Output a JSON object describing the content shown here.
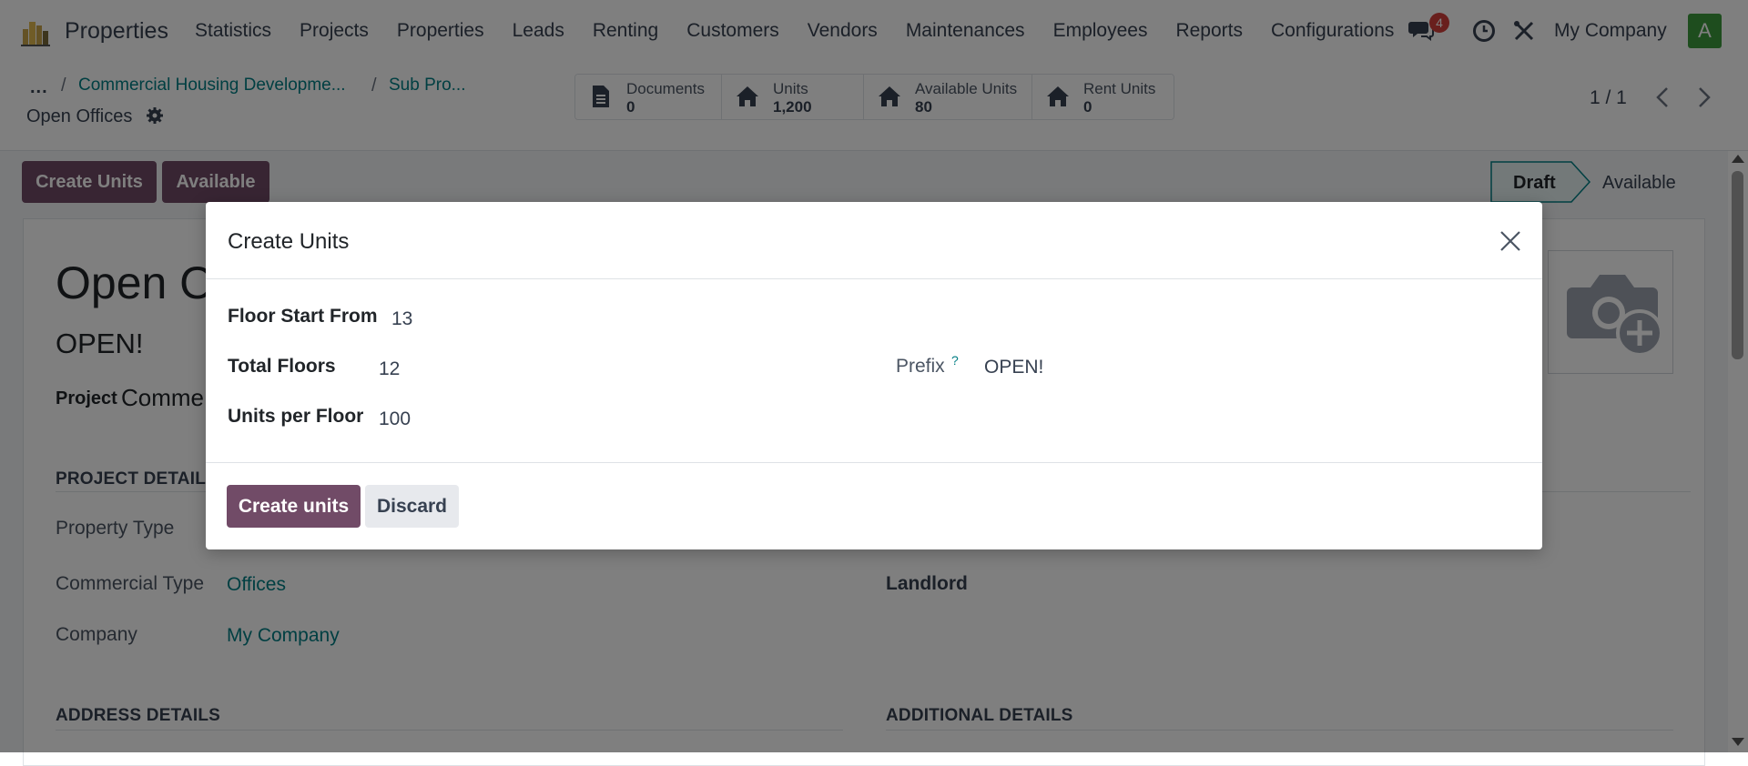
{
  "nav": {
    "app_name": "Properties",
    "menu": [
      "Statistics",
      "Projects",
      "Properties",
      "Leads",
      "Renting",
      "Customers",
      "Vendors",
      "Maintenances",
      "Employees",
      "Reports",
      "Configurations"
    ],
    "chat_badge": "4",
    "company": "My Company",
    "avatar_letter": "A"
  },
  "breadcrumb": {
    "ellipsis": "...",
    "sep": "/",
    "items": [
      "Commercial Housing Developme...",
      "Sub Pro..."
    ],
    "current": "Open Offices"
  },
  "smart_buttons": [
    {
      "label": "Documents",
      "value": "0",
      "icon": "document-icon"
    },
    {
      "label": "Units",
      "value": "1,200",
      "icon": "home-icon"
    },
    {
      "label": "Available Units",
      "value": "80",
      "icon": "home-icon"
    },
    {
      "label": "Rent Units",
      "value": "0",
      "icon": "home-icon"
    }
  ],
  "pager": {
    "text": "1 / 1"
  },
  "actions": {
    "create_units": "Create Units",
    "available": "Available"
  },
  "status": {
    "draft": "Draft",
    "available": "Available",
    "active": "Draft"
  },
  "form": {
    "title": "Open O",
    "subtitle": "OPEN!",
    "project_label": "Project",
    "project_value": "Comme",
    "section_project": "PROJECT DETAILS",
    "property_type_label": "Property Type",
    "commercial_type_label": "Commercial Type",
    "commercial_type_value": "Offices",
    "company_label": "Company",
    "company_value": "My Company",
    "landlord_label": "Landlord",
    "section_address": "ADDRESS DETAILS",
    "section_additional": "ADDITIONAL DETAILS"
  },
  "modal": {
    "title": "Create Units",
    "floor_start_label": "Floor Start From",
    "floor_start_value": "13",
    "total_floors_label": "Total Floors",
    "total_floors_value": "12",
    "units_per_floor_label": "Units per Floor",
    "units_per_floor_value": "100",
    "prefix_label": "Prefix",
    "prefix_help": "?",
    "prefix_value": "OPEN!",
    "create_button": "Create units",
    "discard_button": "Discard"
  },
  "colors": {
    "primary": "#714b67",
    "link": "#017e84",
    "badge": "#d23f3a",
    "avatar": "#3c9a3c"
  }
}
